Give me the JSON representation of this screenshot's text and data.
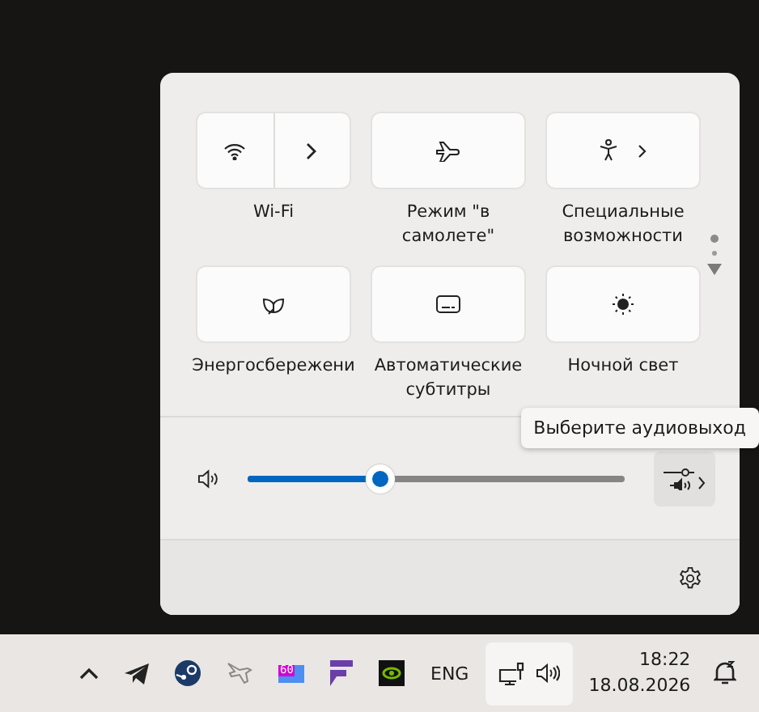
{
  "quick_settings": {
    "tiles": [
      {
        "label": "Wi-Fi",
        "kind": "split",
        "on": false
      },
      {
        "label": "Режим \"в самолете\"",
        "kind": "single",
        "on": false
      },
      {
        "label": "Специальные возможности",
        "kind": "expand",
        "on": false
      },
      {
        "label": "Энергосбережени",
        "kind": "single",
        "on": false
      },
      {
        "label": "Автоматические субтитры",
        "kind": "single",
        "on": false
      },
      {
        "label": "Ночной свет",
        "kind": "single",
        "on": false
      }
    ],
    "pages": [
      {
        "selected": true
      },
      {
        "selected": false
      }
    ],
    "volume": {
      "level": 0.35
    },
    "tooltip": "Выберите аудиовыход"
  },
  "taskbar": {
    "fps_badge": "60",
    "language": "ENG",
    "time": "18:22",
    "date": "18.08.2026"
  }
}
